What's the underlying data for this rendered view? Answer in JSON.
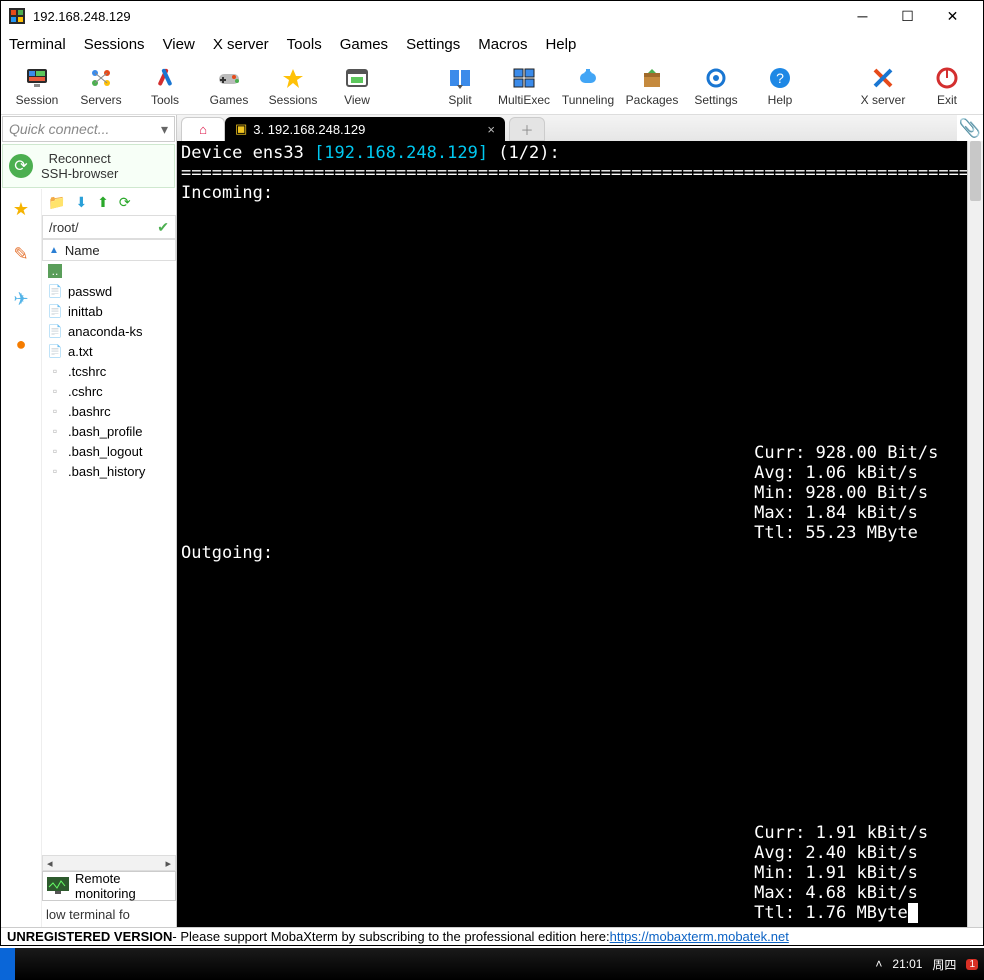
{
  "window": {
    "title": "192.168.248.129"
  },
  "menubar": [
    "Terminal",
    "Sessions",
    "View",
    "X server",
    "Tools",
    "Games",
    "Settings",
    "Macros",
    "Help"
  ],
  "toolbar": [
    {
      "label": "Session",
      "icon": "session"
    },
    {
      "label": "Servers",
      "icon": "servers"
    },
    {
      "label": "Tools",
      "icon": "tools"
    },
    {
      "label": "Games",
      "icon": "games"
    },
    {
      "label": "Sessions",
      "icon": "sessions"
    },
    {
      "label": "View",
      "icon": "view"
    },
    {
      "label": "Split",
      "icon": "split"
    },
    {
      "label": "MultiExec",
      "icon": "multiexec"
    },
    {
      "label": "Tunneling",
      "icon": "tunneling"
    },
    {
      "label": "Packages",
      "icon": "packages"
    },
    {
      "label": "Settings",
      "icon": "settings"
    },
    {
      "label": "Help",
      "icon": "help"
    },
    {
      "label": "X server",
      "icon": "xserver"
    },
    {
      "label": "Exit",
      "icon": "exit"
    }
  ],
  "quick_connect_placeholder": "Quick connect...",
  "reconnect": {
    "line1": "Reconnect",
    "line2": "SSH-browser"
  },
  "fp_path": "/root/",
  "fp_header": "Name",
  "files": [
    {
      "name": "..",
      "type": "up"
    },
    {
      "name": "passwd",
      "type": "file"
    },
    {
      "name": "inittab",
      "type": "file"
    },
    {
      "name": "anaconda-ks",
      "type": "script"
    },
    {
      "name": "a.txt",
      "type": "txt"
    },
    {
      "name": ".tcshrc",
      "type": "hidden"
    },
    {
      "name": ".cshrc",
      "type": "hidden"
    },
    {
      "name": ".bashrc",
      "type": "hidden"
    },
    {
      "name": ".bash_profile",
      "type": "hidden"
    },
    {
      "name": ".bash_logout",
      "type": "hidden"
    },
    {
      "name": ".bash_history",
      "type": "hidden"
    }
  ],
  "remote_monitoring": "Remote\nmonitoring",
  "follow_terminal": "low terminal fo",
  "tab_active": "3. 192.168.248.129",
  "terminal": {
    "line1_prefix": "Device ens33 ",
    "line1_ip": "[192.168.248.129]",
    "line1_suffix": " (1/2):",
    "rule": "===============================================================================",
    "incoming_label": "Incoming:",
    "incoming_stats": {
      "curr": "Curr: 928.00 Bit/s",
      "avg": "Avg: 1.06 kBit/s",
      "min": "Min: 928.00 Bit/s",
      "max": "Max: 1.84 kBit/s",
      "ttl": "Ttl: 55.23 MByte"
    },
    "outgoing_label": "Outgoing:",
    "outgoing_stats": {
      "curr": "Curr: 1.91 kBit/s",
      "avg": "Avg: 2.40 kBit/s",
      "min": "Min: 1.91 kBit/s",
      "max": "Max: 4.68 kBit/s",
      "ttl": "Ttl: 1.76 MByte"
    }
  },
  "statusbar": {
    "unreg": "UNREGISTERED VERSION",
    "mid": " -  Please support MobaXterm by subscribing to the professional edition here:  ",
    "link": "https://mobaxterm.mobatek.net"
  },
  "taskbar": {
    "time": "21:01",
    "day": "周四",
    "badge": "1"
  }
}
